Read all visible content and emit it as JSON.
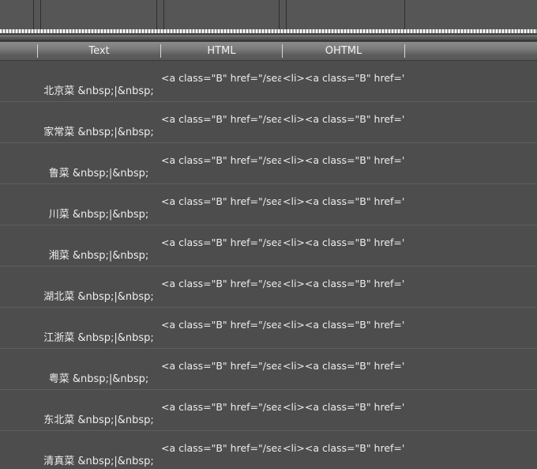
{
  "grid": {
    "columns": [
      {
        "key": "blank_left",
        "label": ""
      },
      {
        "key": "text",
        "label": "Text"
      },
      {
        "key": "html",
        "label": "HTML"
      },
      {
        "key": "ohtml",
        "label": "OHTML"
      },
      {
        "key": "blank_right",
        "label": ""
      }
    ],
    "rows": [
      {
        "text": "北京菜 &nbsp;|&nbsp;",
        "html": "<a class=\"B\" href=\"/sear",
        "ohtml": "<li><a class=\"B\" href=\"/",
        "extra": ""
      },
      {
        "text": "家常菜 &nbsp;|&nbsp;",
        "html": "<a class=\"B\" href=\"/sear",
        "ohtml": "<li><a class=\"B\" href=\"/",
        "extra": ""
      },
      {
        "text": "鲁菜 &nbsp;|&nbsp;",
        "html": "<a class=\"B\" href=\"/sear",
        "ohtml": "<li><a class=\"B\" href=\"/",
        "extra": ""
      },
      {
        "text": "川菜 &nbsp;|&nbsp;",
        "html": "<a class=\"B\" href=\"/sear",
        "ohtml": "<li><a class=\"B\" href=\"/",
        "extra": ""
      },
      {
        "text": "湘菜 &nbsp;|&nbsp;",
        "html": "<a class=\"B\" href=\"/sear",
        "ohtml": "<li><a class=\"B\" href=\"/",
        "extra": ""
      },
      {
        "text": "湖北菜 &nbsp;|&nbsp;",
        "html": "<a class=\"B\" href=\"/sear",
        "ohtml": "<li><a class=\"B\" href=\"/",
        "extra": ""
      },
      {
        "text": "江浙菜 &nbsp;|&nbsp;",
        "html": "<a class=\"B\" href=\"/sear",
        "ohtml": "<li><a class=\"B\" href=\"/",
        "extra": ""
      },
      {
        "text": "粤菜 &nbsp;|&nbsp;",
        "html": "<a class=\"B\" href=\"/sear",
        "ohtml": "<li><a class=\"B\" href=\"/",
        "extra": ""
      },
      {
        "text": "东北菜 &nbsp;|&nbsp;",
        "html": "<a class=\"B\" href=\"/sear",
        "ohtml": "<li><a class=\"B\" href=\"/",
        "extra": ""
      },
      {
        "text": "清真菜 &nbsp;|&nbsp;",
        "html": "<a class=\"B\" href=\"/sear",
        "ohtml": "<li><a class=\"B\" href=\"/",
        "extra": ""
      }
    ]
  },
  "colors": {
    "background": "#4d4d4d",
    "panel": "#565656",
    "header_top": "#8c8c8c",
    "header_bottom": "#565656",
    "row_separator": "#5e5e5e",
    "divider": "#2e2e2e",
    "text": "#ededed"
  }
}
